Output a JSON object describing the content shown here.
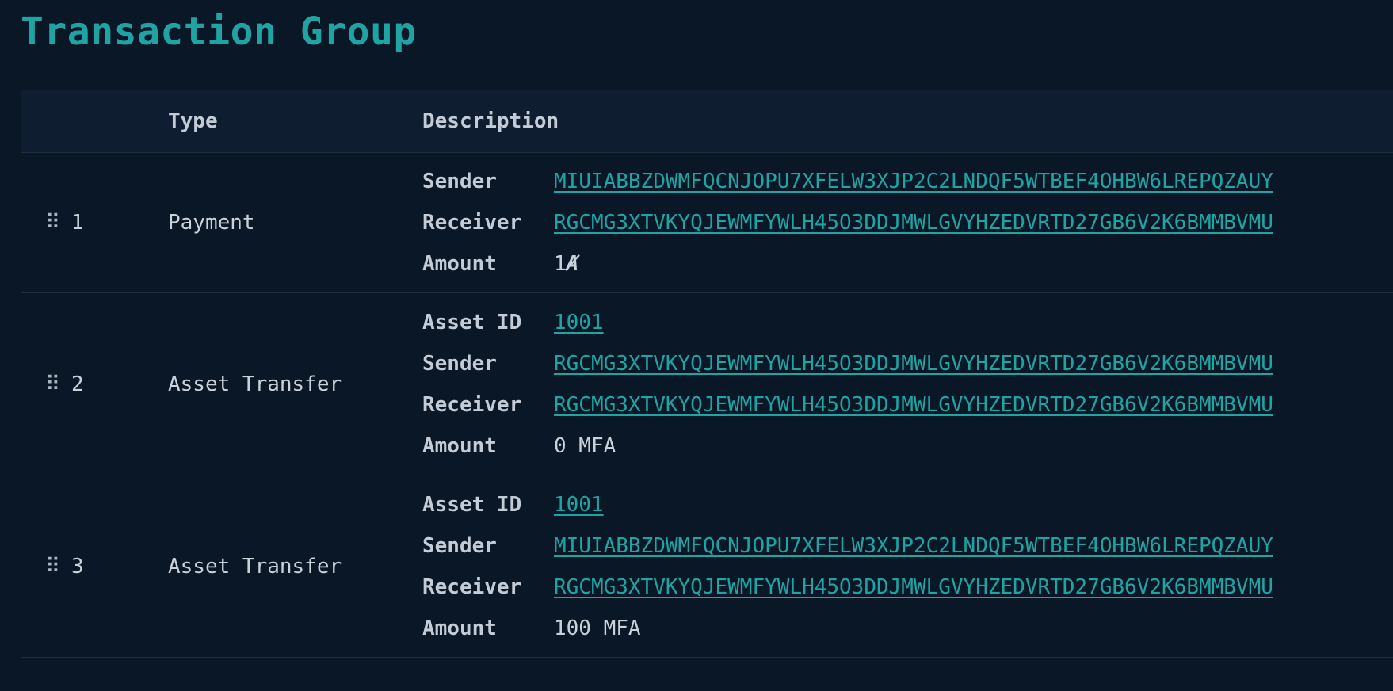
{
  "title": "Transaction Group",
  "columns": {
    "type": "Type",
    "description": "Description"
  },
  "handle_icon": "drag-handle-icon",
  "accent": "#1fa3a3",
  "rows": [
    {
      "index": "1",
      "type": "Payment",
      "sender_label": "Sender",
      "sender": "MIUIABBZDWMFQCNJOPU7XFELW3XJP2C2LNDQF5WTBEF4OHBW6LREPQZAUY",
      "receiver_label": "Receiver",
      "receiver": "RGCMG3XTVKYQJEWMFYWLH45O3DDJMWLGVYHZEDVRTD27GB6V2K6BMMBVMU",
      "amount_label": "Amount",
      "amount": "1",
      "amount_symbol": "Ⱥ"
    },
    {
      "index": "2",
      "type": "Asset Transfer",
      "asset_label": "Asset ID",
      "asset_id": "1001",
      "sender_label": "Sender",
      "sender": "RGCMG3XTVKYQJEWMFYWLH45O3DDJMWLGVYHZEDVRTD27GB6V2K6BMMBVMU",
      "receiver_label": "Receiver",
      "receiver": "RGCMG3XTVKYQJEWMFYWLH45O3DDJMWLGVYHZEDVRTD27GB6V2K6BMMBVMU",
      "amount_label": "Amount",
      "amount": "0 MFA"
    },
    {
      "index": "3",
      "type": "Asset Transfer",
      "asset_label": "Asset ID",
      "asset_id": "1001",
      "sender_label": "Sender",
      "sender": "MIUIABBZDWMFQCNJOPU7XFELW3XJP2C2LNDQF5WTBEF4OHBW6LREPQZAUY",
      "receiver_label": "Receiver",
      "receiver": "RGCMG3XTVKYQJEWMFYWLH45O3DDJMWLGVYHZEDVRTD27GB6V2K6BMMBVMU",
      "amount_label": "Amount",
      "amount": "100 MFA"
    }
  ]
}
